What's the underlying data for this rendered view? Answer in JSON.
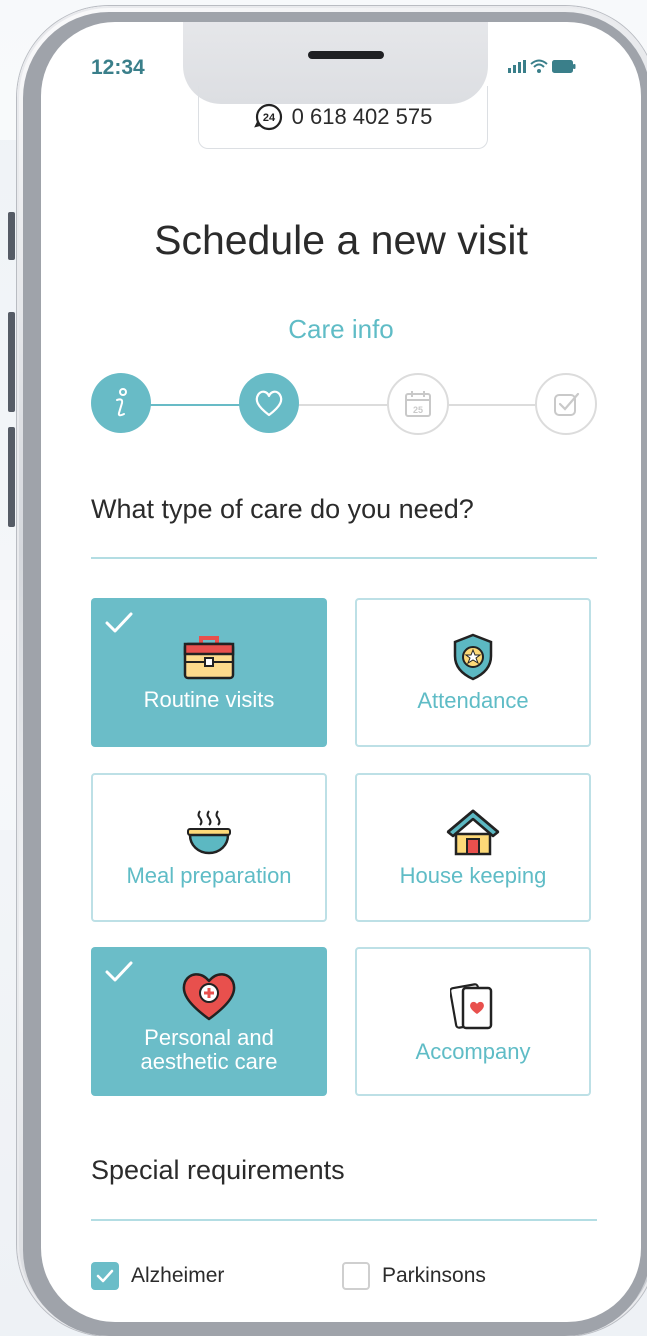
{
  "status_bar": {
    "time": "12:34"
  },
  "contact": {
    "phone": "0 618 402 575",
    "icon": "24h-phone-icon"
  },
  "page": {
    "title": "Schedule a new visit",
    "step_name": "Care info"
  },
  "stepper": {
    "steps": [
      {
        "name": "info",
        "icon": "info-icon",
        "state": "complete"
      },
      {
        "name": "care",
        "icon": "heart-icon",
        "state": "active"
      },
      {
        "name": "date",
        "icon": "calendar-icon",
        "calendar_day": "25",
        "state": "inactive"
      },
      {
        "name": "confirm",
        "icon": "checklist-icon",
        "state": "inactive"
      }
    ]
  },
  "care_section": {
    "question": "What type of care do you need?",
    "options": [
      {
        "label": "Routine visits",
        "icon": "toolbox-icon",
        "selected": true
      },
      {
        "label": "Attendance",
        "icon": "shield-star-icon",
        "selected": false
      },
      {
        "label": "Meal preparation",
        "icon": "soup-bowl-icon",
        "selected": false
      },
      {
        "label": "House keeping",
        "icon": "house-icon",
        "selected": false
      },
      {
        "label": "Personal and\naesthetic care",
        "label_line1": "Personal and",
        "label_line2": "aesthetic care",
        "icon": "heart-plus-icon",
        "selected": true
      },
      {
        "label": "Accompany",
        "icon": "playing-cards-icon",
        "selected": false
      }
    ]
  },
  "requirements": {
    "title": "Special requirements",
    "items": [
      {
        "label": "Alzheimer",
        "checked": true
      },
      {
        "label": "Parkinsons",
        "checked": false
      }
    ]
  },
  "colors": {
    "accent": "#6bbdc8",
    "accent_text": "#5fbcc6",
    "divider": "#b3dde3",
    "text": "#2b2b2b"
  }
}
